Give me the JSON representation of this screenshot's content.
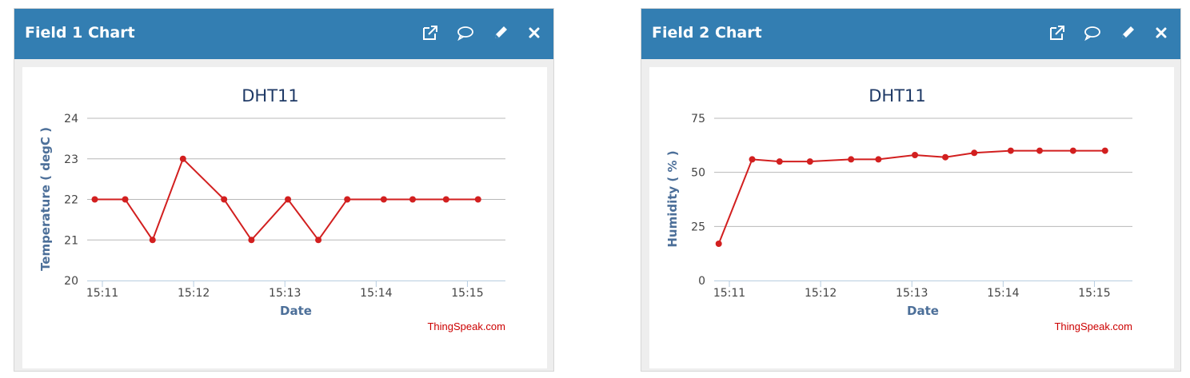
{
  "panels": [
    {
      "title": "Field 1 Chart"
    },
    {
      "title": "Field 2 Chart"
    }
  ],
  "icons": [
    "external-link-icon",
    "comment-icon",
    "pencil-icon",
    "close-icon"
  ],
  "chart_data": [
    {
      "type": "line",
      "title": "DHT11",
      "xlabel": "Date",
      "ylabel": "Temperature ( degC )",
      "ylim": [
        20,
        24
      ],
      "yticks": [
        20,
        21,
        22,
        23,
        24
      ],
      "xlim": [
        "15:10:50",
        "15:15:25"
      ],
      "xticks": [
        "15:11",
        "15:12",
        "15:13",
        "15:14",
        "15:15"
      ],
      "grid": true,
      "credit": "ThingSpeak.com",
      "color": "#d21f1f",
      "series": [
        {
          "x": [
            "15:10:55",
            "15:11:15",
            "15:11:33",
            "15:11:53",
            "15:12:20",
            "15:12:38",
            "15:13:02",
            "15:13:22",
            "15:13:41",
            "15:14:05",
            "15:14:24",
            "15:14:46",
            "15:15:07"
          ],
          "values": [
            22,
            22,
            21,
            23,
            22,
            21,
            22,
            21,
            22,
            22,
            22,
            22,
            22
          ]
        }
      ]
    },
    {
      "type": "line",
      "title": "DHT11",
      "xlabel": "Date",
      "ylabel": "Humidity ( % )",
      "ylim": [
        0,
        75
      ],
      "yticks": [
        0,
        25,
        50,
        75
      ],
      "xlim": [
        "15:10:50",
        "15:15:25"
      ],
      "xticks": [
        "15:11",
        "15:12",
        "15:13",
        "15:14",
        "15:15"
      ],
      "grid": true,
      "credit": "ThingSpeak.com",
      "color": "#d21f1f",
      "series": [
        {
          "x": [
            "15:10:53",
            "15:11:15",
            "15:11:33",
            "15:11:53",
            "15:12:20",
            "15:12:38",
            "15:13:02",
            "15:13:22",
            "15:13:41",
            "15:14:05",
            "15:14:24",
            "15:14:46",
            "15:15:07"
          ],
          "values": [
            17,
            56,
            55,
            55,
            56,
            56,
            58,
            57,
            59,
            60,
            60,
            60,
            60
          ]
        }
      ]
    }
  ]
}
